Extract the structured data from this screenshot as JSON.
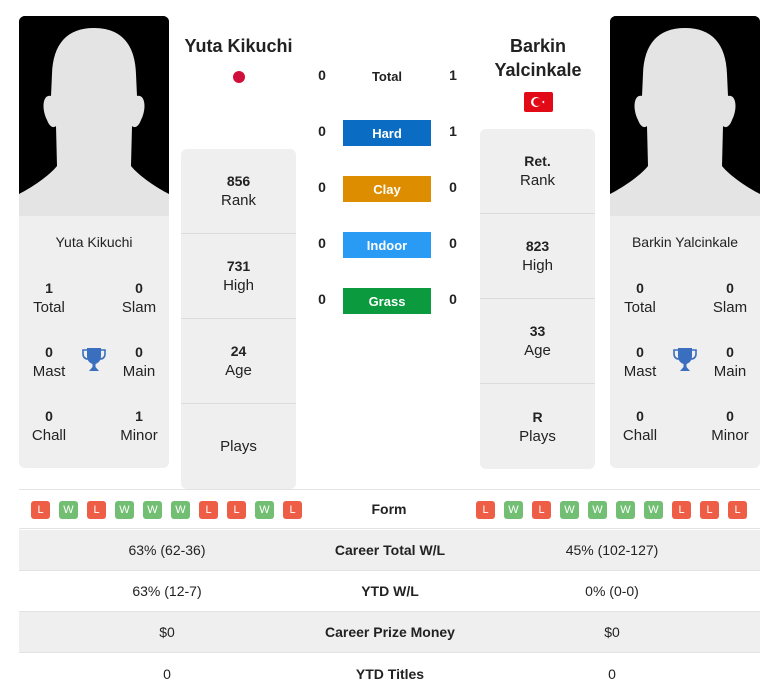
{
  "player1": {
    "name": "Yuta Kikuchi",
    "flag": "japan-flag",
    "card_name": "Yuta Kikuchi",
    "rank": {
      "value": "856",
      "label": "Rank"
    },
    "high": {
      "value": "731",
      "label": "High"
    },
    "age": {
      "value": "24",
      "label": "Age"
    },
    "plays": {
      "value": "",
      "label": "Plays"
    },
    "titles": {
      "total": {
        "value": "1",
        "label": "Total"
      },
      "slam": {
        "value": "0",
        "label": "Slam"
      },
      "mast": {
        "value": "0",
        "label": "Mast"
      },
      "main": {
        "value": "0",
        "label": "Main"
      },
      "chall": {
        "value": "0",
        "label": "Chall"
      },
      "minor": {
        "value": "1",
        "label": "Minor"
      }
    },
    "form": [
      "L",
      "W",
      "L",
      "W",
      "W",
      "W",
      "L",
      "L",
      "W",
      "L"
    ]
  },
  "player2": {
    "name_line1": "Barkin",
    "name_line2": "Yalcinkale",
    "flag": "turkey-flag",
    "card_name": "Barkin Yalcinkale",
    "rank": {
      "value": "Ret.",
      "label": "Rank"
    },
    "high": {
      "value": "823",
      "label": "High"
    },
    "age": {
      "value": "33",
      "label": "Age"
    },
    "plays": {
      "value": "R",
      "label": "Plays"
    },
    "titles": {
      "total": {
        "value": "0",
        "label": "Total"
      },
      "slam": {
        "value": "0",
        "label": "Slam"
      },
      "mast": {
        "value": "0",
        "label": "Mast"
      },
      "main": {
        "value": "0",
        "label": "Main"
      },
      "chall": {
        "value": "0",
        "label": "Chall"
      },
      "minor": {
        "value": "0",
        "label": "Minor"
      }
    },
    "form": [
      "L",
      "W",
      "L",
      "W",
      "W",
      "W",
      "W",
      "L",
      "L",
      "L"
    ]
  },
  "h2h": {
    "total": {
      "label": "Total",
      "p1": "0",
      "p2": "1"
    },
    "surfaces": [
      {
        "label": "Hard",
        "p1": "0",
        "p2": "1",
        "color": "#0a6cc2"
      },
      {
        "label": "Clay",
        "p1": "0",
        "p2": "0",
        "color": "#dc8e00"
      },
      {
        "label": "Indoor",
        "p1": "0",
        "p2": "0",
        "color": "#2a9bf5"
      },
      {
        "label": "Grass",
        "p1": "0",
        "p2": "0",
        "color": "#0b9a3e"
      }
    ]
  },
  "form_label": "Form",
  "comparison": [
    {
      "label": "Career Total W/L",
      "p1": "63% (62-36)",
      "p2": "45% (102-127)"
    },
    {
      "label": "YTD W/L",
      "p1": "63% (12-7)",
      "p2": "0% (0-0)"
    },
    {
      "label": "Career Prize Money",
      "p1": "$0",
      "p2": "$0"
    },
    {
      "label": "YTD Titles",
      "p1": "0",
      "p2": "0"
    }
  ]
}
